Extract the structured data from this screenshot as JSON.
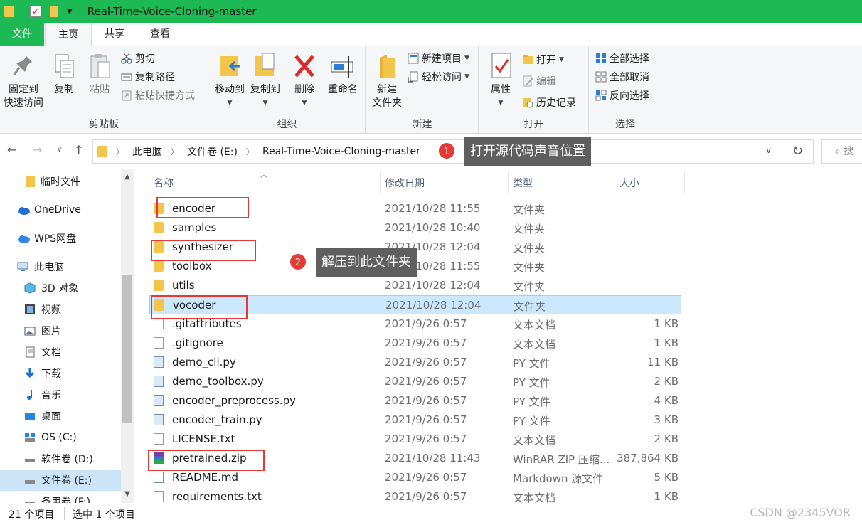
{
  "window": {
    "title": "Real-Time-Voice-Cloning-master"
  },
  "ribbon_tabs": {
    "file": "文件",
    "home": "主页",
    "share": "共享",
    "view": "查看"
  },
  "ribbon": {
    "clipboard": {
      "label": "剪贴板",
      "pin": "固定到\n快速访问",
      "copy": "复制",
      "paste": "粘贴",
      "cut": "剪切",
      "copy_path": "复制路径",
      "paste_shortcut": "粘贴快捷方式"
    },
    "organize": {
      "label": "组织",
      "move_to": "移动到",
      "copy_to": "复制到",
      "delete": "删除",
      "rename": "重命名"
    },
    "new": {
      "label": "新建",
      "new_folder": "新建\n文件夹",
      "new_item": "新建项目",
      "easy_access": "轻松访问"
    },
    "open": {
      "label": "打开",
      "properties": "属性",
      "open": "打开",
      "edit": "编辑",
      "history": "历史记录"
    },
    "select": {
      "label": "选择",
      "select_all": "全部选择",
      "select_none": "全部取消",
      "invert": "反向选择"
    }
  },
  "address": {
    "crumbs": [
      "此电脑",
      "文件卷 (E:)",
      "Real-Time-Voice-Cloning-master"
    ],
    "search_placeholder": "搜"
  },
  "annotations": [
    {
      "num": "1",
      "text": "打开源代码声音位置"
    },
    {
      "num": "2",
      "text": "解压到此文件夹"
    }
  ],
  "nav": {
    "items": [
      {
        "label": "临时文件",
        "icon": "folder-icon"
      },
      {
        "label": "OneDrive",
        "icon": "cloud-icon"
      },
      {
        "label": "WPS网盘",
        "icon": "cloud-icon"
      },
      {
        "label": "此电脑",
        "icon": "computer-icon"
      },
      {
        "label": "3D 对象",
        "icon": "cube-icon"
      },
      {
        "label": "视频",
        "icon": "film-icon"
      },
      {
        "label": "图片",
        "icon": "picture-icon"
      },
      {
        "label": "文档",
        "icon": "document-icon"
      },
      {
        "label": "下载",
        "icon": "download-icon"
      },
      {
        "label": "音乐",
        "icon": "music-icon"
      },
      {
        "label": "桌面",
        "icon": "desktop-icon"
      },
      {
        "label": "OS (C:)",
        "icon": "drive-icon"
      },
      {
        "label": "软件卷 (D:)",
        "icon": "drive-icon"
      },
      {
        "label": "文件卷 (E:)",
        "icon": "drive-icon"
      },
      {
        "label": "备用卷 (F:)",
        "icon": "drive-icon"
      }
    ]
  },
  "columns": {
    "name": "名称",
    "date": "修改日期",
    "type": "类型",
    "size": "大小"
  },
  "files": [
    {
      "name": "encoder",
      "date": "2021/10/28 11:55",
      "type": "文件夹",
      "size": "",
      "icon": "folder"
    },
    {
      "name": "samples",
      "date": "2021/10/28 10:40",
      "type": "文件夹",
      "size": "",
      "icon": "folder"
    },
    {
      "name": "synthesizer",
      "date": "2021/10/28 12:04",
      "type": "文件夹",
      "size": "",
      "icon": "folder"
    },
    {
      "name": "toolbox",
      "date": "2021/10/28 11:55",
      "type": "文件夹",
      "size": "",
      "icon": "folder"
    },
    {
      "name": "utils",
      "date": "2021/10/28 12:04",
      "type": "文件夹",
      "size": "",
      "icon": "folder"
    },
    {
      "name": "vocoder",
      "date": "2021/10/28 12:04",
      "type": "文件夹",
      "size": "",
      "icon": "folder"
    },
    {
      "name": ".gitattributes",
      "date": "2021/9/26 0:57",
      "type": "文本文档",
      "size": "1 KB",
      "icon": "doc"
    },
    {
      "name": ".gitignore",
      "date": "2021/9/26 0:57",
      "type": "文本文档",
      "size": "1 KB",
      "icon": "doc"
    },
    {
      "name": "demo_cli.py",
      "date": "2021/9/26 0:57",
      "type": "PY 文件",
      "size": "11 KB",
      "icon": "py"
    },
    {
      "name": "demo_toolbox.py",
      "date": "2021/9/26 0:57",
      "type": "PY 文件",
      "size": "2 KB",
      "icon": "py"
    },
    {
      "name": "encoder_preprocess.py",
      "date": "2021/9/26 0:57",
      "type": "PY 文件",
      "size": "4 KB",
      "icon": "py"
    },
    {
      "name": "encoder_train.py",
      "date": "2021/9/26 0:57",
      "type": "PY 文件",
      "size": "3 KB",
      "icon": "py"
    },
    {
      "name": "LICENSE.txt",
      "date": "2021/9/26 0:57",
      "type": "文本文档",
      "size": "2 KB",
      "icon": "doc"
    },
    {
      "name": "pretrained.zip",
      "date": "2021/10/28 11:43",
      "type": "WinRAR ZIP 压缩...",
      "size": "387,864 KB",
      "icon": "zip"
    },
    {
      "name": "README.md",
      "date": "2021/9/26 0:57",
      "type": "Markdown 源文件",
      "size": "5 KB",
      "icon": "md"
    },
    {
      "name": "requirements.txt",
      "date": "2021/9/26 0:57",
      "type": "文本文档",
      "size": "1 KB",
      "icon": "doc"
    }
  ],
  "status": {
    "count": "21 个项目",
    "selected": "选中 1 个项目"
  },
  "watermark": "CSDN @2345VOR",
  "colors": {
    "titlebar": "#1db954",
    "selection": "#cce8ff",
    "highlight_box": "#e53935"
  }
}
